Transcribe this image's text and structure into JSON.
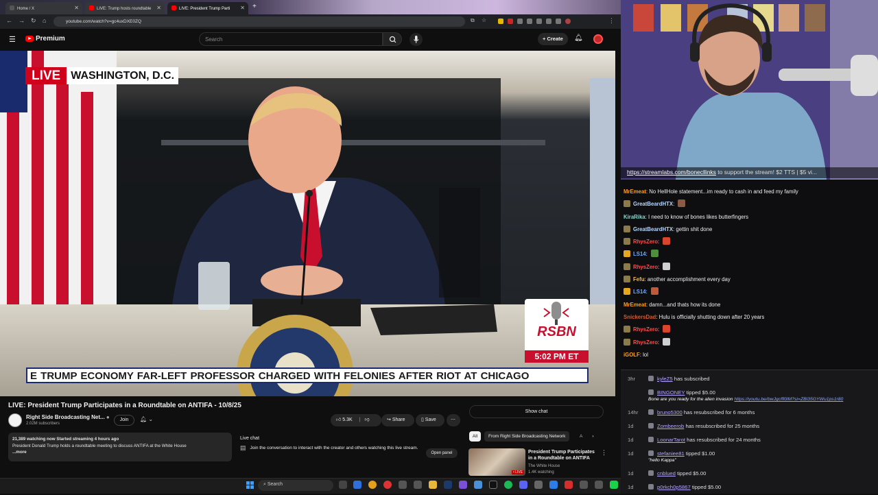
{
  "browser": {
    "tabs": [
      {
        "title": "Home / X",
        "color": "#1d1d1d"
      },
      {
        "title": "LIVE: Trump hosts roundtable",
        "color": "#ff0000"
      },
      {
        "title": "LIVE: President Trump Parti",
        "color": "#ff0000"
      }
    ],
    "url": "youtube.com/watch?v=gc4uxDXE0ZQ"
  },
  "youtube": {
    "brand": "Premium",
    "search_placeholder": "Search",
    "create_label": "Create"
  },
  "video": {
    "live_label": "LIVE",
    "location": "WASHINGTON, D.C.",
    "network_logo": "RSBN",
    "time": "5:02 PM ET",
    "ticker": "E TRUMP ECONOMY    FAR-LEFT PROFESSOR CHARGED WITH FELONIES AFTER RIOT AT CHICAGO"
  },
  "meta": {
    "title": "LIVE: President Trump Participates in a Roundtable on ANTIFA - 10/8/25",
    "channel": "Right Side Broadcasting Net...",
    "subscribers": "2.02M subscribers",
    "join": "Join",
    "likes": "5.3K",
    "share": "Share",
    "save": "Save",
    "description_line1": "21,389 watching now  Started streaming 4 hours ago",
    "description_line2": "President Donald Trump holds a roundtable meeting to discuss ANTIFA at the White House",
    "description_more": "...more"
  },
  "live_chat": {
    "title": "Live chat",
    "prompt": "Join the conversation to interact with the creator and others watching this live stream.",
    "open_panel": "Open panel",
    "show_chat": "Show chat"
  },
  "recommendations": {
    "chips": [
      "All",
      "From Right Side Broadcasting Network",
      "A"
    ],
    "item": {
      "title": "President Trump Participates in a Roundtable on ANTIFA",
      "channel": "The White House",
      "watching": "1.4K watching"
    }
  },
  "taskbar": {
    "search_label": "Search"
  },
  "stream": {
    "link_text": "https://streamlabs.com/bonecllinks",
    "link_suffix": " to support the stream! $2 TTS | $5 vi..."
  },
  "chat_messages": [
    {
      "user": "MrEmeat",
      "text": "No HellHole statement...im ready to cash in and feed my family",
      "color": "#ff9f1a",
      "badge": null,
      "emote": null
    },
    {
      "user": "GreatBeardHTX",
      "text": "",
      "color": "#b8d7ff",
      "badge": "#8b7a4a",
      "emote": "#8a5a44"
    },
    {
      "user": "KiraRika",
      "text": "I need to know of bones likes butterfingers",
      "color": "#7fdcd0",
      "badge": null,
      "emote": null
    },
    {
      "user": "GreatBeardHTX",
      "text": "gettin shit done",
      "color": "#b8d7ff",
      "badge": "#8b7a4a",
      "emote": null
    },
    {
      "user": "RhysZero",
      "text": "",
      "color": "#ff4d4d",
      "badge": "#8b7a4a",
      "emote": "#d9462b"
    },
    {
      "user": "LS14",
      "text": "",
      "color": "#6aa8ff",
      "badge": "#e7a620",
      "emote": "#4e8f3a"
    },
    {
      "user": "RhysZero",
      "text": "",
      "color": "#ff4d4d",
      "badge": "#8b7a4a",
      "emote": "#cfcfcf"
    },
    {
      "user": "Fefu",
      "text": "another accomplishment every day",
      "color": "#f2b84b",
      "badge": "#8b7a4a",
      "emote": null
    },
    {
      "user": "LS14",
      "text": "",
      "color": "#6aa8ff",
      "badge": "#e7a620",
      "emote": "#c0583a"
    },
    {
      "user": "MrEmeat",
      "text": "damn...and thats how its done",
      "color": "#ff9f1a",
      "badge": null,
      "emote": null
    },
    {
      "user": "SnickersDad",
      "text": "Hulu is officially shutting down after 20 years",
      "color": "#d65a2e",
      "badge": null,
      "emote": null
    },
    {
      "user": "RhysZero",
      "text": "",
      "color": "#ff4d4d",
      "badge": "#8b7a4a",
      "emote": "#d9462b"
    },
    {
      "user": "RhysZero",
      "text": "",
      "color": "#ff4d4d",
      "badge": "#8b7a4a",
      "emote": "#cfcfcf"
    },
    {
      "user": "iGOLF",
      "text": "lol",
      "color": "#ff9f1a",
      "badge": null,
      "emote": null
    }
  ],
  "events": [
    {
      "age": "3hr",
      "who": "kyleZ5",
      "action": "has subscribed",
      "quote": null
    },
    {
      "age": "",
      "who": "BINGONEY",
      "action": "tipped $5.00",
      "quote": "Bone are you ready for the alien invasion",
      "link": "https://youtu.be/bwJgcffl0lM?si=ZBl35GYWu1ps1r80"
    },
    {
      "age": "14hr",
      "who": "bruno5300",
      "action": "has resubscribed for 6 months",
      "quote": null
    },
    {
      "age": "1d",
      "who": "Zombeerob",
      "action": "has resubscribed for 25 months",
      "quote": null
    },
    {
      "age": "1d",
      "who": "LoonarTarot",
      "action": "has resubscribed for 24 months",
      "quote": null
    },
    {
      "age": "1d",
      "who": "stefaniee81",
      "action": "tipped $1.00",
      "quote": "\"hello Kappa\""
    },
    {
      "age": "1d",
      "who": "cnblued",
      "action": "tipped $5.00",
      "quote": null
    },
    {
      "age": "1d",
      "who": "p0rkch0p5867",
      "action": "tipped $5.00",
      "quote": null
    }
  ]
}
